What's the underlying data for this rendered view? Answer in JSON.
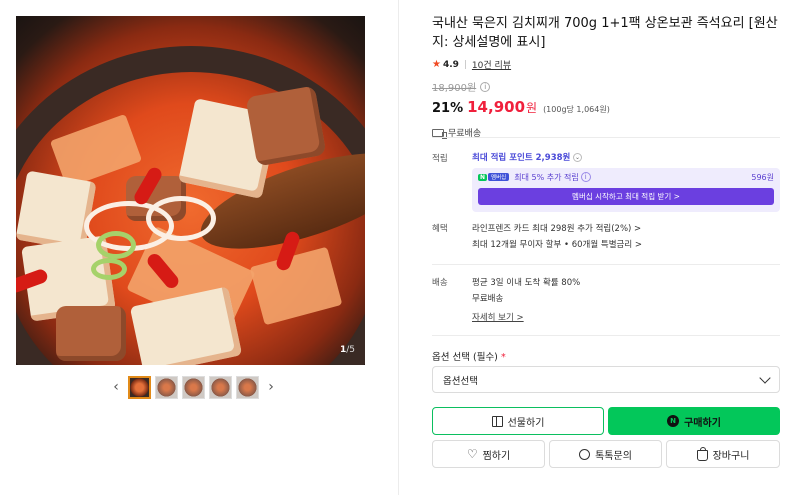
{
  "product": {
    "title": "국내산 묵은지 김치찌개 700g 1+1팩 상온보관 즉석요리 [원산지: 상세설명에 표시]",
    "image_counter_current": "1",
    "image_counter_total": "/5"
  },
  "rating": {
    "score": "4.9",
    "reviews_label": "10건 리뷰"
  },
  "price": {
    "original": "18,900원",
    "discount_rate": "21%",
    "sale": "14,900",
    "currency": "원",
    "unit_price": "(100g당 1,064원)"
  },
  "shipping_badge": "무료배송",
  "points": {
    "label": "적립",
    "max_points_link": "최대 적립 포인트",
    "max_points_value": "2,938원",
    "np_logo": "N",
    "np_badge": "멤버십",
    "np_text": "최대 5% 추가 적립",
    "np_amount": "596원",
    "np_button": "멤버십 시작하고 최대 적립 받기 >"
  },
  "benefits": {
    "label": "혜택",
    "line1": "라인프렌즈 카드 최대 298원 추가 적립(2%) >",
    "line2": "최대 12개월 무이자 할부 • 60개월 특별금리 >"
  },
  "delivery": {
    "label": "배송",
    "line1": "평균 3일 이내 도착 확률 80%",
    "line2": "무료배송",
    "details_link": "자세히 보기 >"
  },
  "options": {
    "label": "옵션 선택 (필수)",
    "required_mark": "*",
    "select_value": "옵션선택"
  },
  "buttons": {
    "gift": "선물하기",
    "buy": "구매하기",
    "buy_icon_letter": "N",
    "wish": "찜하기",
    "talk": "톡톡문의",
    "cart": "장바구니"
  },
  "icons": {
    "star": "star-icon",
    "info": "info-circle-icon",
    "truck": "truck-icon",
    "chevron": "chevron-down-icon",
    "gift": "gift-icon",
    "naver_pay": "naver-n-icon",
    "heart": "heart-icon",
    "talk": "chat-bubble-icon",
    "cart": "shopping-bag-icon"
  },
  "colors": {
    "sale_red": "#f0203c",
    "naver_green": "#03c75a",
    "membership_purple": "#6b3fe0",
    "thumb_active": "#e28b19"
  }
}
